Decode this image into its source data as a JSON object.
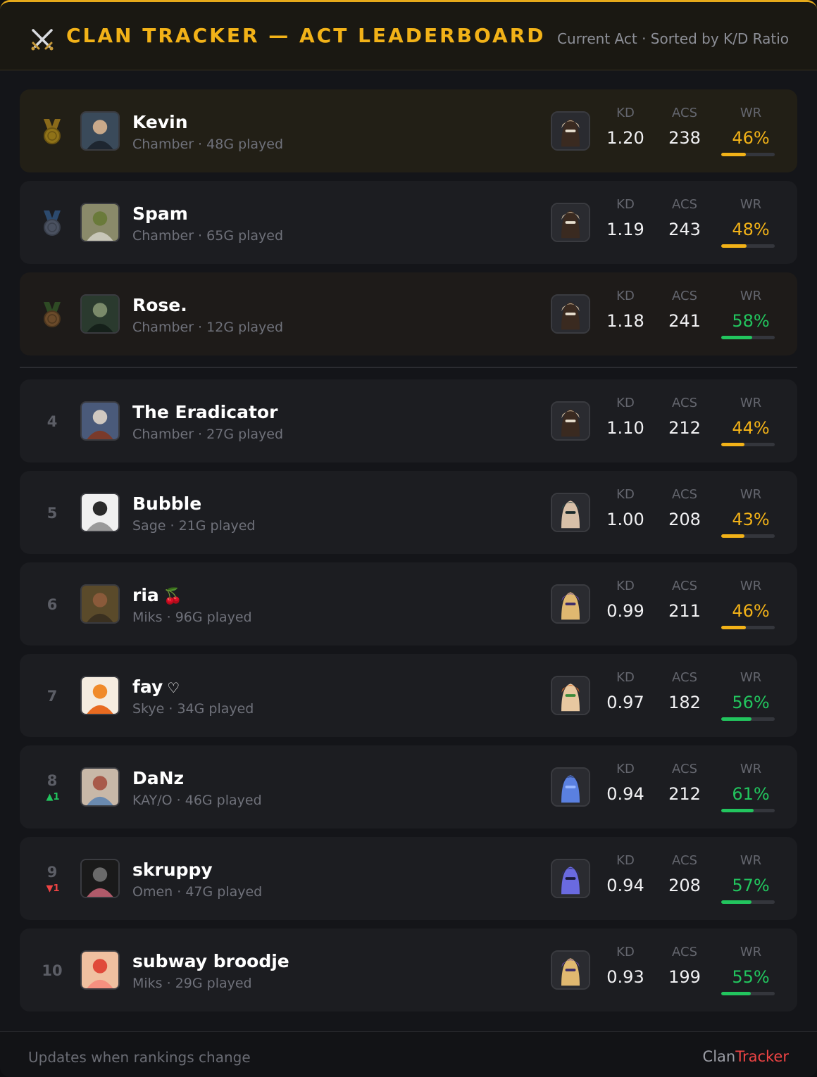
{
  "header": {
    "title": "CLAN TRACKER — ACT LEADERBOARD",
    "subtitle": "Current Act · Sorted by K/D Ratio",
    "icon": "crossed-swords-icon"
  },
  "labels": {
    "kd": "KD",
    "acs": "ACS",
    "wr": "WR"
  },
  "colors": {
    "accent": "#f2b218",
    "good": "#22c55e",
    "bad": "#ef4444"
  },
  "players": [
    {
      "rank": "1",
      "medal": "gold",
      "name": "Kevin",
      "extra": "",
      "meta": "Chamber · 48G played",
      "agent": "chamber",
      "kd": "1.20",
      "acs": "238",
      "wr": "46%",
      "wr_value": 46,
      "wr_tone": "yellow"
    },
    {
      "rank": "2",
      "medal": "silver",
      "name": "Spam",
      "extra": "",
      "meta": "Chamber · 65G played",
      "agent": "chamber",
      "kd": "1.19",
      "acs": "243",
      "wr": "48%",
      "wr_value": 48,
      "wr_tone": "yellow"
    },
    {
      "rank": "3",
      "medal": "bronze",
      "name": "Rose.",
      "extra": "",
      "meta": "Chamber · 12G played",
      "agent": "chamber",
      "kd": "1.18",
      "acs": "241",
      "wr": "58%",
      "wr_value": 58,
      "wr_tone": "green"
    },
    {
      "rank": "4",
      "medal": "",
      "name": "The Eradicator",
      "extra": "",
      "meta": "Chamber · 27G played",
      "agent": "chamber",
      "kd": "1.10",
      "acs": "212",
      "wr": "44%",
      "wr_value": 44,
      "wr_tone": "yellow"
    },
    {
      "rank": "5",
      "medal": "",
      "name": "Bubble",
      "extra": "",
      "meta": "Sage · 21G played",
      "agent": "sage",
      "kd": "1.00",
      "acs": "208",
      "wr": "43%",
      "wr_value": 43,
      "wr_tone": "yellow"
    },
    {
      "rank": "6",
      "medal": "",
      "name": "ria",
      "extra": "🍒",
      "meta": "Miks · 96G played",
      "agent": "miks",
      "kd": "0.99",
      "acs": "211",
      "wr": "46%",
      "wr_value": 46,
      "wr_tone": "yellow"
    },
    {
      "rank": "7",
      "medal": "",
      "name": "fay",
      "extra": "♡",
      "meta": "Skye · 34G played",
      "agent": "skye",
      "kd": "0.97",
      "acs": "182",
      "wr": "56%",
      "wr_value": 56,
      "wr_tone": "green"
    },
    {
      "rank": "8",
      "medal": "",
      "move": "▲1",
      "move_dir": "up",
      "name": "DaNz",
      "extra": "",
      "meta": "KAY/O · 46G played",
      "agent": "kayo",
      "kd": "0.94",
      "acs": "212",
      "wr": "61%",
      "wr_value": 61,
      "wr_tone": "green"
    },
    {
      "rank": "9",
      "medal": "",
      "move": "▼1",
      "move_dir": "down",
      "name": "skruppy",
      "extra": "",
      "meta": "Omen · 47G played",
      "agent": "omen",
      "kd": "0.94",
      "acs": "208",
      "wr": "57%",
      "wr_value": 57,
      "wr_tone": "green"
    },
    {
      "rank": "10",
      "medal": "",
      "name": "subway broodje",
      "extra": "",
      "meta": "Miks · 29G played",
      "agent": "miks",
      "kd": "0.93",
      "acs": "199",
      "wr": "55%",
      "wr_value": 55,
      "wr_tone": "green"
    }
  ],
  "footer": {
    "left": "Updates when rankings change",
    "brand_a": "Clan",
    "brand_b": "Tracker"
  }
}
